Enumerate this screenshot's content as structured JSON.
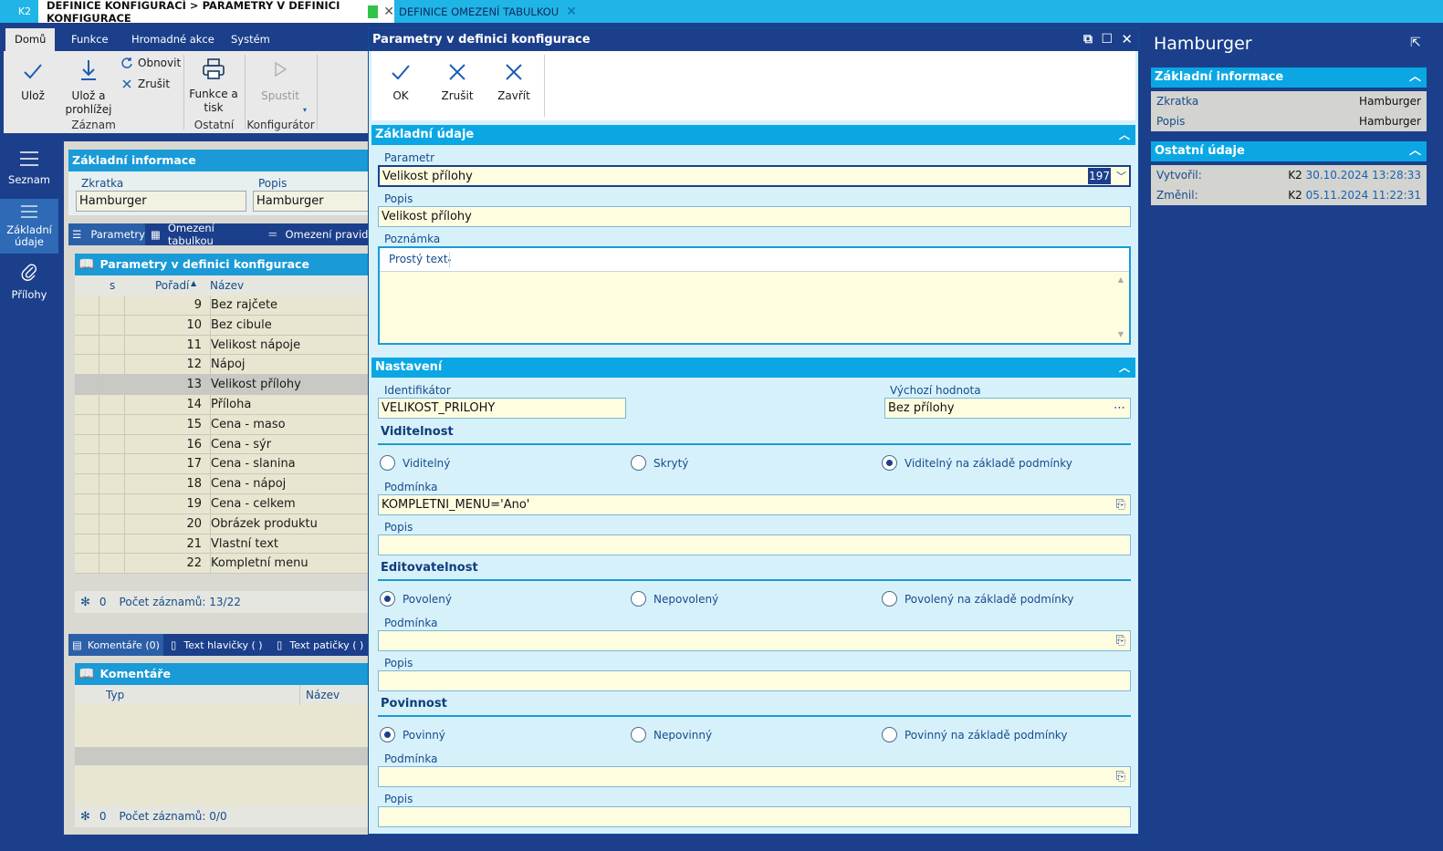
{
  "top_tabs": {
    "k2": "K2",
    "active": "DEFINICE KONFIGURACÍ > PARAMETRY V DEFINICI KONFIGURACE",
    "second": "DEFINICE OMEZENÍ TABULKOU"
  },
  "ribbon": {
    "tabs": [
      "Domů",
      "Funkce",
      "Hromadné akce",
      "Systém"
    ],
    "uloz": "Ulož",
    "uloz_prohlizej_1": "Ulož a",
    "uloz_prohlizej_2": "prohlížej",
    "obnovit": "Obnovit",
    "zrusit": "Zrušit",
    "funkce_tisk_1": "Funkce a",
    "funkce_tisk_2": "tisk",
    "spustit": "Spustit",
    "group_zaznam": "Záznam",
    "group_ostatni": "Ostatní",
    "group_konfigurator": "Konfigurátor"
  },
  "leftnav": {
    "seznam": "Seznam",
    "zakladni_1": "Základní",
    "zakladni_2": "údaje",
    "prilohy": "Přílohy"
  },
  "main": {
    "section_title": "Základní informace",
    "zkratka_label": "Zkratka",
    "zkratka_value": "Hamburger",
    "popis_label": "Popis",
    "popis_value": "Hamburger",
    "subtabs": [
      "Parametry",
      "Omezení tabulkou",
      "Omezení pravidle"
    ],
    "grid_title": "Parametry v definici konfigurace",
    "grid_cols": {
      "s": "s",
      "poradi": "Pořadí",
      "nazev": "Název"
    },
    "rows": [
      {
        "poradi": "9",
        "nazev": "Bez rajčete"
      },
      {
        "poradi": "10",
        "nazev": "Bez cibule"
      },
      {
        "poradi": "11",
        "nazev": "Velikost nápoje"
      },
      {
        "poradi": "12",
        "nazev": "Nápoj"
      },
      {
        "poradi": "13",
        "nazev": "Velikost přílohy"
      },
      {
        "poradi": "14",
        "nazev": "Příloha"
      },
      {
        "poradi": "15",
        "nazev": "Cena - maso"
      },
      {
        "poradi": "16",
        "nazev": "Cena - sýr"
      },
      {
        "poradi": "17",
        "nazev": "Cena - slanina"
      },
      {
        "poradi": "18",
        "nazev": "Cena - nápoj"
      },
      {
        "poradi": "19",
        "nazev": "Cena - celkem"
      },
      {
        "poradi": "20",
        "nazev": "Obrázek produktu"
      },
      {
        "poradi": "21",
        "nazev": "Vlastní text"
      },
      {
        "poradi": "22",
        "nazev": "Kompletní menu"
      }
    ],
    "footer_count": "0",
    "footer_text": "Počet záznamů: 13/22",
    "bottom_tabs": [
      "Komentáře (0)",
      "Text hlavičky ( )",
      "Text patičky ( )"
    ],
    "comments_title": "Komentáře",
    "comments_cols": {
      "typ": "Typ",
      "nazev": "Název"
    },
    "comments_footer_count": "0",
    "comments_footer_text": "Počet záznamů: 0/0"
  },
  "dialog": {
    "title": "Parametry v definici konfigurace",
    "ok": "OK",
    "zrusit": "Zrušit",
    "zavrit": "Zavřít",
    "zakladni_udaje": "Základní údaje",
    "parametr_label": "Parametr",
    "parametr_value": "Velikost přílohy",
    "parametr_id": "197",
    "popis_label": "Popis",
    "popis_value": "Velikost přílohy",
    "poznamka_label": "Poznámka",
    "prosty_text": "Prostý text",
    "nastaveni": "Nastavení",
    "identifikator_label": "Identifikátor",
    "identifikator_value": "VELIKOST_PRILOHY",
    "vychozi_label": "Výchozí hodnota",
    "vychozi_value": "Bez přílohy",
    "viditelnost": {
      "title": "Viditelnost",
      "options": [
        "Viditelný",
        "Skrytý",
        "Viditelný na základě podmínky"
      ],
      "selected": 2,
      "podminka_label": "Podmínka",
      "podminka_value": "KOMPLETNI_MENU='Ano'",
      "popis_label": "Popis",
      "popis_value": ""
    },
    "editovatelnost": {
      "title": "Editovatelnost",
      "options": [
        "Povolený",
        "Nepovolený",
        "Povolený na základě podmínky"
      ],
      "selected": 0,
      "podminka_label": "Podmínka",
      "podminka_value": "",
      "popis_label": "Popis",
      "popis_value": ""
    },
    "povinnost": {
      "title": "Povinnost",
      "options": [
        "Povinný",
        "Nepovinný",
        "Povinný na základě podmínky"
      ],
      "selected": 0,
      "podminka_label": "Podmínka",
      "podminka_value": "",
      "popis_label": "Popis",
      "popis_value": ""
    }
  },
  "right_panel": {
    "title": "Hamburger",
    "zakladni_informace": "Základní informace",
    "zkratka_label": "Zkratka",
    "zkratka_value": "Hamburger",
    "popis_label": "Popis",
    "popis_value": "Hamburger",
    "ostatni_udaje": "Ostatní údaje",
    "vytvoril_label": "Vytvořil:",
    "vytvoril_user": "K2",
    "vytvoril_date": "30.10.2024 13:28:33",
    "zmenil_label": "Změnil:",
    "zmenil_user": "K2",
    "zmenil_date": "05.11.2024 11:22:31"
  },
  "colors": {
    "navy": "#1b3f8b",
    "accent": "#0aa7e4",
    "field_yellow": "#fffde0"
  }
}
